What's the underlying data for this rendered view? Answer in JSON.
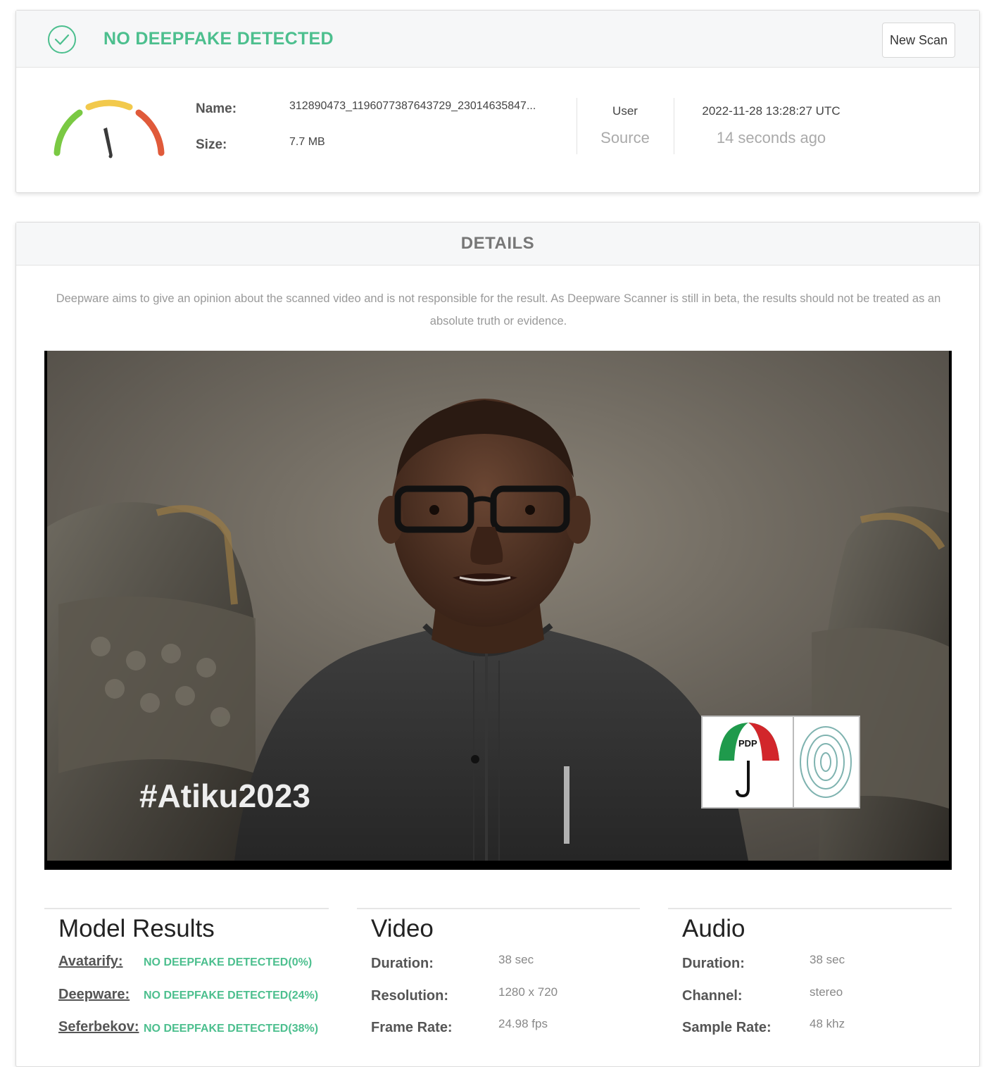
{
  "summary": {
    "verdict": "NO DEEPFAKE DETECTED",
    "new_scan_label": "New Scan",
    "name_label": "Name:",
    "name_value": "312890473_1196077387643729_23014635847...",
    "size_label": "Size:",
    "size_value": "7.7 MB",
    "source_top": "User",
    "source_bottom": "Source",
    "timestamp": "2022-11-28 13:28:27 UTC",
    "relative_time": "14 seconds ago",
    "gauge_level": "low",
    "icons": [
      "check-circle-icon",
      "gauge-icon"
    ]
  },
  "details": {
    "title": "DETAILS",
    "disclaimer": "Deepware aims to give an opinion about the scanned video and is not responsible for the result. As Deepware Scanner is still in beta, the results should not be treated as an absolute truth or evidence.",
    "video": {
      "overlay_hashtag": "#Atiku2023",
      "logo_text": "PDP"
    },
    "model_results": {
      "title": "Model Results",
      "items": [
        {
          "model": "Avatarify:",
          "result": "NO DEEPFAKE DETECTED(0%)"
        },
        {
          "model": "Deepware:",
          "result": "NO DEEPFAKE DETECTED(24%)"
        },
        {
          "model": "Seferbekov:",
          "result": "NO DEEPFAKE DETECTED(38%)"
        }
      ]
    },
    "video_info": {
      "title": "Video",
      "rows": [
        {
          "label": "Duration:",
          "value": "38 sec"
        },
        {
          "label": "Resolution:",
          "value": "1280 x 720"
        },
        {
          "label": "Frame Rate:",
          "value": "24.98 fps"
        }
      ]
    },
    "audio_info": {
      "title": "Audio",
      "rows": [
        {
          "label": "Duration:",
          "value": "38 sec"
        },
        {
          "label": "Channel:",
          "value": "stereo"
        },
        {
          "label": "Sample Rate:",
          "value": "48 khz"
        }
      ]
    }
  },
  "colors": {
    "accent_green": "#4cbf8e",
    "gauge_green": "#7ac943",
    "gauge_yellow": "#f2c94c",
    "gauge_red": "#e05a3a"
  }
}
